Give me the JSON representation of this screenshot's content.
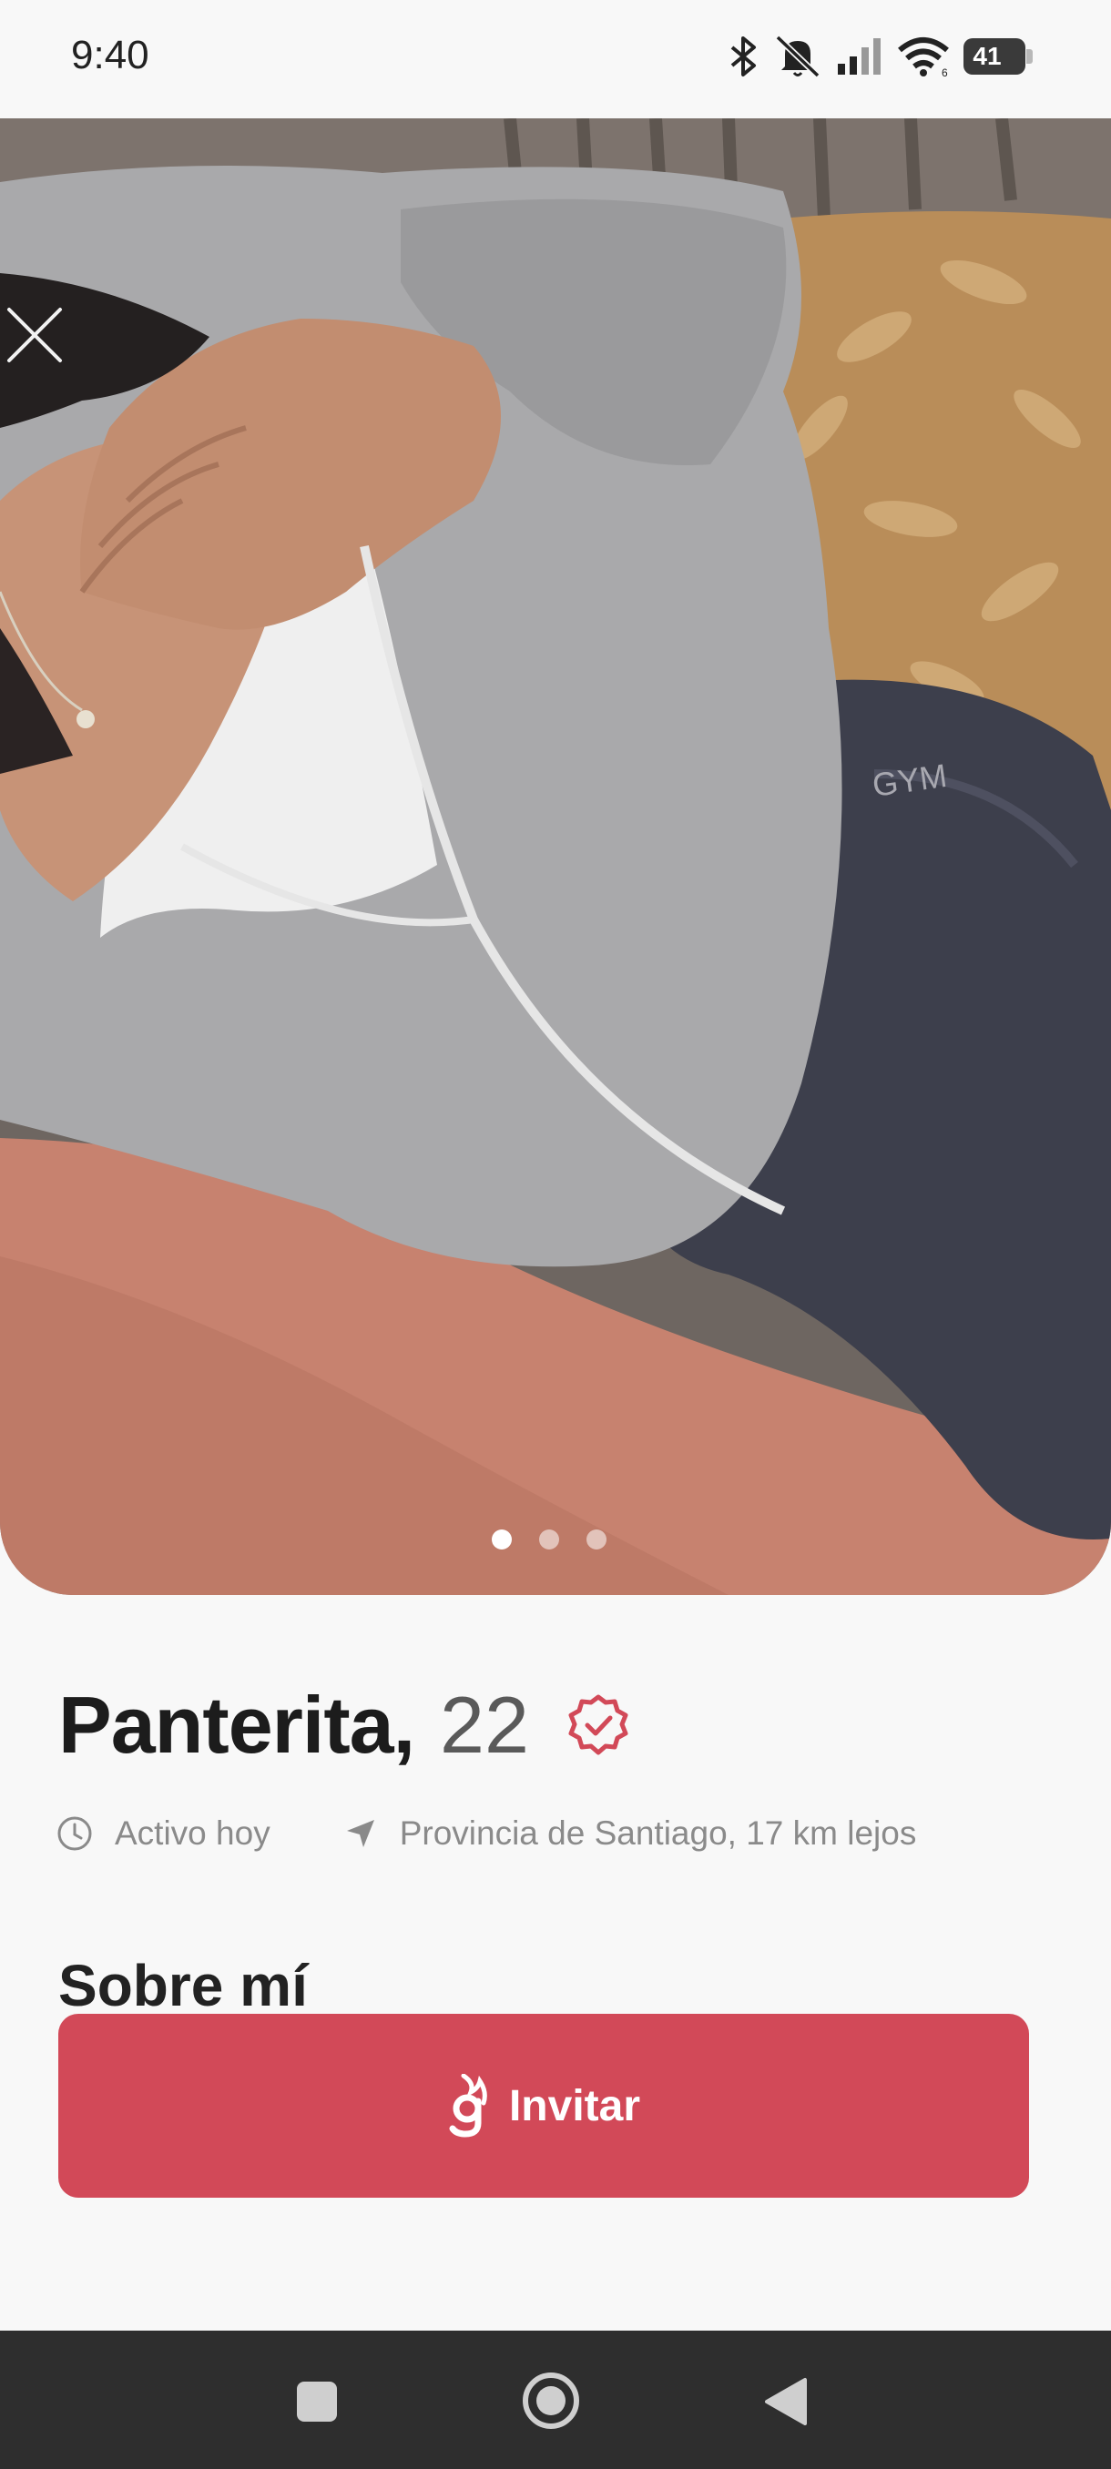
{
  "status_bar": {
    "time": "9:40",
    "battery_level": "41",
    "icons": [
      "bluetooth-icon",
      "notifications-off-icon",
      "signal-icon",
      "wifi-icon",
      "battery-icon"
    ]
  },
  "photo": {
    "pages_total": 3,
    "active_page": 1,
    "close_icon": "close-icon"
  },
  "profile": {
    "name": "Panterita,",
    "age": "22",
    "verified": true,
    "activity": "Activo hoy",
    "location": "Provincia de Santiago, 17 km lejos"
  },
  "about": {
    "title": "Sobre mí"
  },
  "invite_button": {
    "label": "Invitar",
    "icon": "flame-g-icon"
  },
  "colors": {
    "accent": "#d24958",
    "text_primary": "#1c1c1c",
    "text_secondary": "#8a8a8a",
    "nav_bar": "#2e2e2e"
  },
  "nav_bar": {
    "buttons": [
      "recents-button",
      "home-button",
      "back-button"
    ]
  }
}
